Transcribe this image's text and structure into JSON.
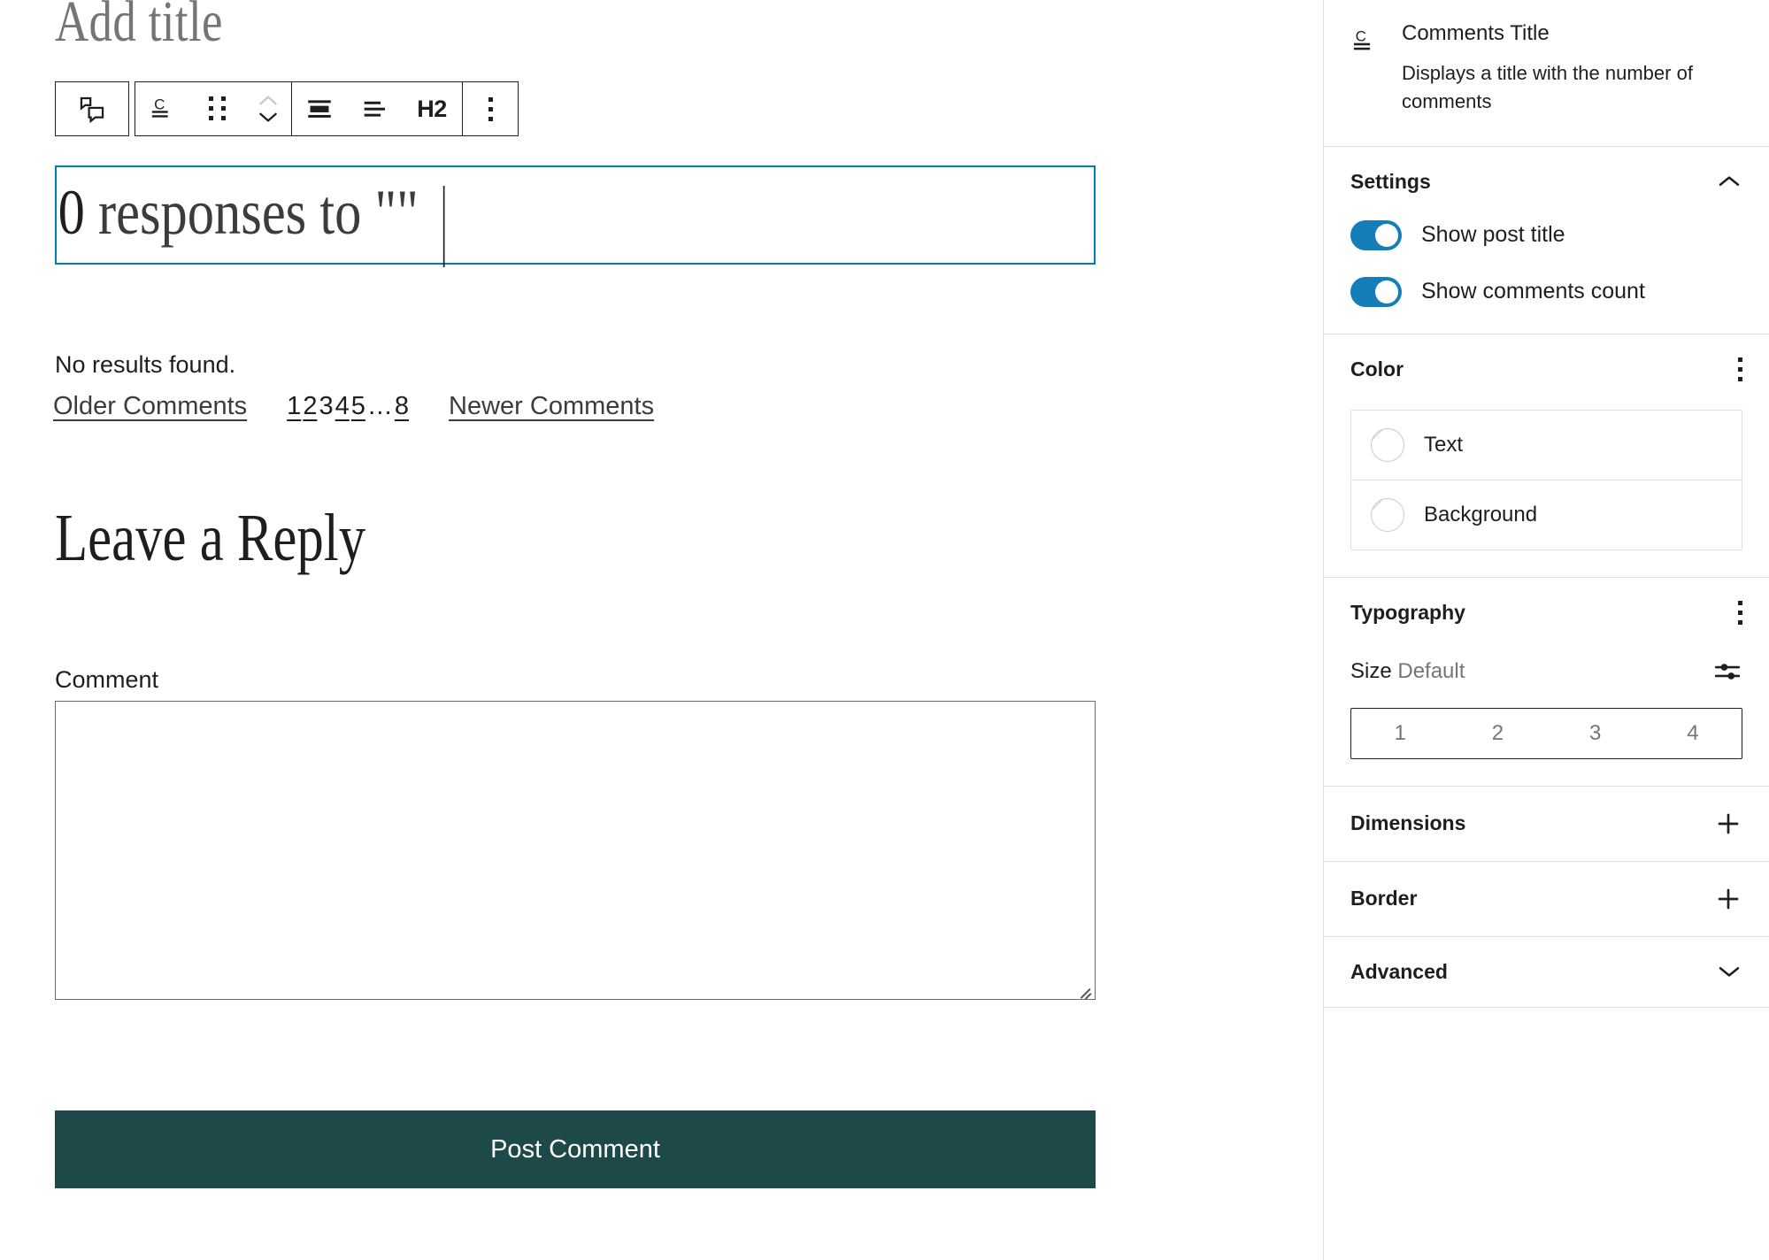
{
  "editor": {
    "post_title_placeholder": "Add title",
    "toolbar": {
      "parent_block_label": "Select parent block: Comments",
      "block_type_label": "Comments Title",
      "drag_label": "Drag",
      "move_up_label": "Move up",
      "move_down_label": "Move down",
      "align_label": "Align",
      "text_align_label": "Align text",
      "heading_level_label": "H2",
      "options_label": "Options"
    },
    "heading": {
      "count_text": "0",
      "body_text": " responses to ",
      "quotes": "\"\""
    },
    "comments": {
      "no_results": "No results found.",
      "older_label": "Older Comments",
      "newer_label": "Newer Comments",
      "pages": [
        "1",
        "2",
        "3",
        "4",
        "5"
      ],
      "ellipsis": "…",
      "last_page": "8",
      "current_page": "3"
    },
    "reply": {
      "heading": "Leave a Reply",
      "comment_label": "Comment",
      "comment_value": "",
      "submit_label": "Post Comment",
      "submit_color": "#1d4a48"
    }
  },
  "sidebar": {
    "block_card": {
      "icon": "comments-title-icon",
      "title": "Comments Title",
      "description": "Displays a title with the number of comments"
    },
    "settings": {
      "title": "Settings",
      "collapse_icon": "chevron-up-icon",
      "toggles": [
        {
          "label": "Show post title",
          "state": "on"
        },
        {
          "label": "Show comments count",
          "state": "on"
        }
      ]
    },
    "color": {
      "title": "Color",
      "menu_icon": "ellipsis-vertical-icon",
      "items": [
        {
          "label": "Text",
          "swatch": "none"
        },
        {
          "label": "Background",
          "swatch": "none"
        }
      ]
    },
    "typography": {
      "title": "Typography",
      "menu_icon": "ellipsis-vertical-icon",
      "size_label": "Size",
      "size_value": "Default",
      "size_settings_icon": "sliders-icon",
      "size_options": [
        "1",
        "2",
        "3",
        "4"
      ]
    },
    "dimensions": {
      "title": "Dimensions",
      "icon": "plus-icon"
    },
    "border": {
      "title": "Border",
      "icon": "plus-icon"
    },
    "advanced": {
      "title": "Advanced",
      "icon": "chevron-down-icon"
    }
  },
  "colors": {
    "accent_blue": "#007cba",
    "toggle_blue": "#147eb8",
    "button_teal": "#1d4a48",
    "border_grey": "#e0e0e0",
    "text": "#1e1e1e"
  }
}
